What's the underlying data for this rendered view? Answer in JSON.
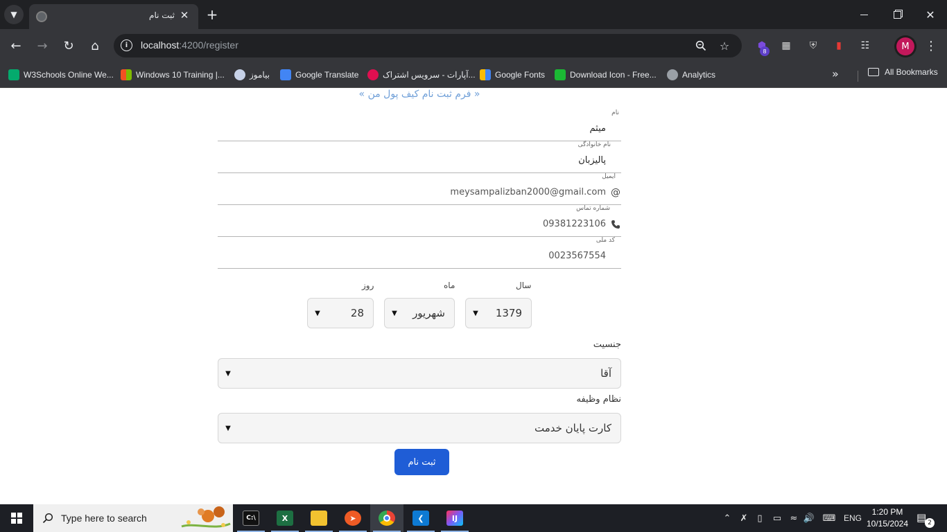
{
  "browser": {
    "tab_title": "ثبت نام",
    "url_host": "localhost",
    "url_path": ":4200/register",
    "profile_initial": "M",
    "extension_badge": "8"
  },
  "bookmarks": [
    {
      "label": "W3Schools Online We...",
      "color": "#04aa6d"
    },
    {
      "label": "Windows 10 Training |...",
      "color": "#f25022"
    },
    {
      "label": "بیاموز",
      "color": "#c7d2e8"
    },
    {
      "label": "Google Translate",
      "color": "#4285f4"
    },
    {
      "label": "آپارات - سرویس اشتراک...",
      "color": "#df0f50"
    },
    {
      "label": "Google Fonts",
      "color": "#fbbc04"
    },
    {
      "label": "Download Icon - Free...",
      "color": "#1bb934"
    },
    {
      "label": "Analytics",
      "color": "#9aa0a6"
    }
  ],
  "bookmarks_all": "All Bookmarks",
  "form": {
    "title": "« فرم ثبت نام کیف پول من »",
    "first_name": {
      "label": "نام",
      "value": "میثم"
    },
    "last_name": {
      "label": "نام خانوادگی",
      "value": "پالیزبان"
    },
    "email": {
      "label": "ایمیل",
      "value": "meysampalizban2000@gmail.com"
    },
    "phone": {
      "label": "شماره تماس",
      "value": "09381223106"
    },
    "national_code": {
      "label": "کد ملی",
      "value": "0023567554"
    },
    "birth": {
      "year_label": "سال",
      "year_value": "1379",
      "month_label": "ماه",
      "month_value": "شهریور",
      "day_label": "روز",
      "day_value": "28"
    },
    "gender": {
      "label": "جنسیت",
      "value": "آقا"
    },
    "military": {
      "label": "نظام وظیفه",
      "value": "کارت پایان خدمت"
    },
    "submit_label": "ثبت نام"
  },
  "taskbar": {
    "search_placeholder": "Type here to search",
    "language": "ENG",
    "time": "1:20 PM",
    "date": "10/15/2024",
    "notifications": "2"
  }
}
